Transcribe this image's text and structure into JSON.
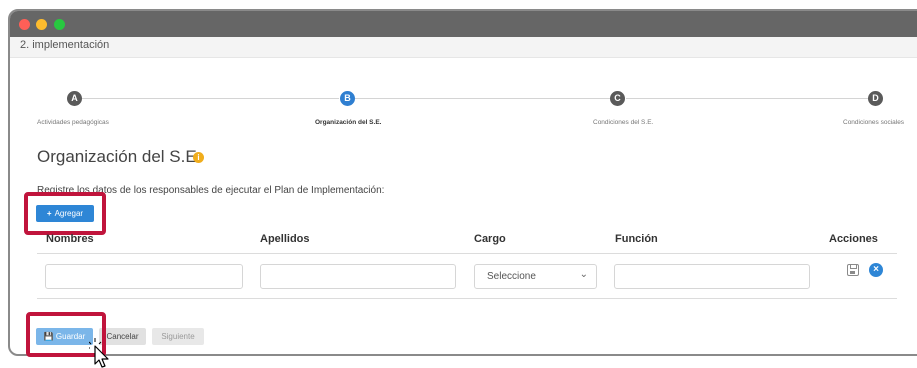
{
  "window": {
    "breadcrumb": "2. implementación"
  },
  "stepper": {
    "steps": [
      {
        "letter": "A",
        "label": "Actividades pedagógicas",
        "state": "inactive"
      },
      {
        "letter": "B",
        "label": "Organización del S.E.",
        "state": "active"
      },
      {
        "letter": "C",
        "label": "Condiciones del S.E.",
        "state": "inactive"
      },
      {
        "letter": "D",
        "label": "Condiciones sociales",
        "state": "inactive"
      }
    ]
  },
  "section": {
    "title": "Organización del S.E.",
    "info_icon": "info-icon",
    "instructions": "Registre los datos de los responsables de ejecutar el Plan de Implementación:"
  },
  "buttons": {
    "add_label": "Agregar",
    "save_label": "Guardar",
    "cancel_label": "Cancelar",
    "next_label": "Siguiente"
  },
  "table": {
    "headers": [
      "Nombres",
      "Apellidos",
      "Cargo",
      "Función",
      "Acciones"
    ],
    "row": {
      "nombres": "",
      "apellidos": "",
      "cargo": "Seleccione",
      "funcion": ""
    }
  },
  "colors": {
    "primary": "#2e86d6",
    "highlight": "#c0143c",
    "warning": "#f0ad1c"
  }
}
